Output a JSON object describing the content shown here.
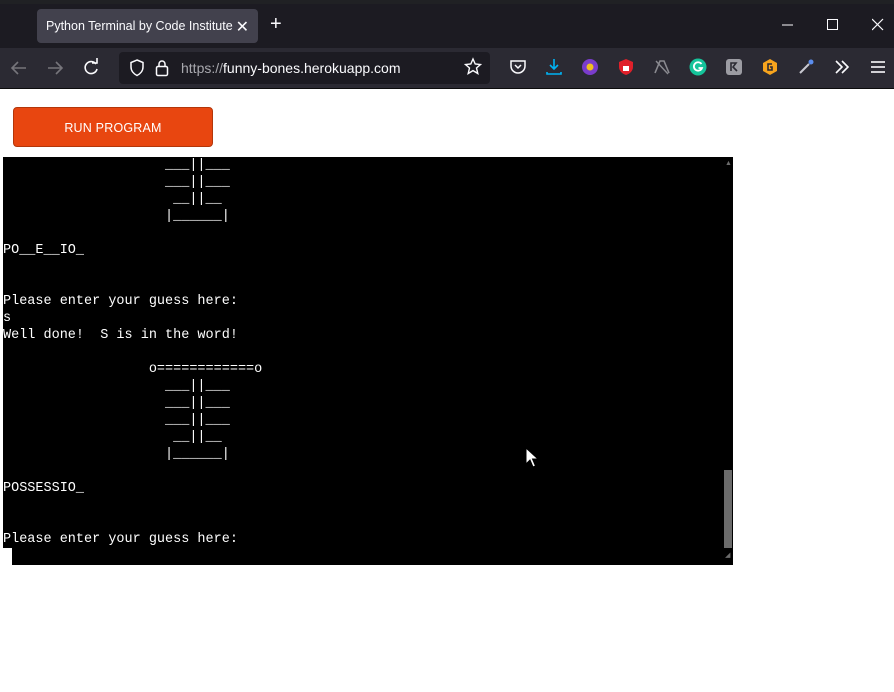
{
  "browser": {
    "tab_title": "Python Terminal by Code Institute",
    "tab_close": "✕",
    "new_tab": "+",
    "url_scheme": "https://",
    "url_host": "funny-bones.herokuapp.com",
    "icons": [
      "back-icon",
      "forward-icon",
      "reload-icon",
      "shield-icon",
      "lock-icon",
      "star-icon",
      "pocket-icon",
      "download-icon",
      "extension-icon",
      "menu-icon"
    ],
    "colors": {
      "titlebar": "#1c1b22",
      "tab": "#42414d",
      "navbar": "#2b2a33",
      "download_accent": "#00b3f4"
    }
  },
  "page": {
    "run_button_label": "RUN PROGRAM",
    "run_button_color": "#e84610"
  },
  "terminal": {
    "lines": [
      "                    ___||___",
      "                    ___||___",
      "                     __||__",
      "                    |______|",
      "",
      "PO__E__IO_",
      "",
      "",
      "Please enter your guess here:",
      "s",
      "Well done!  S is in the word!",
      "",
      "                  o============o",
      "                    ___||___",
      "                    ___||___",
      "                    ___||___",
      "                     __||__",
      "                    |______|",
      "",
      "POSSESSIO_",
      "",
      "",
      "Please enter your guess here:"
    ]
  }
}
